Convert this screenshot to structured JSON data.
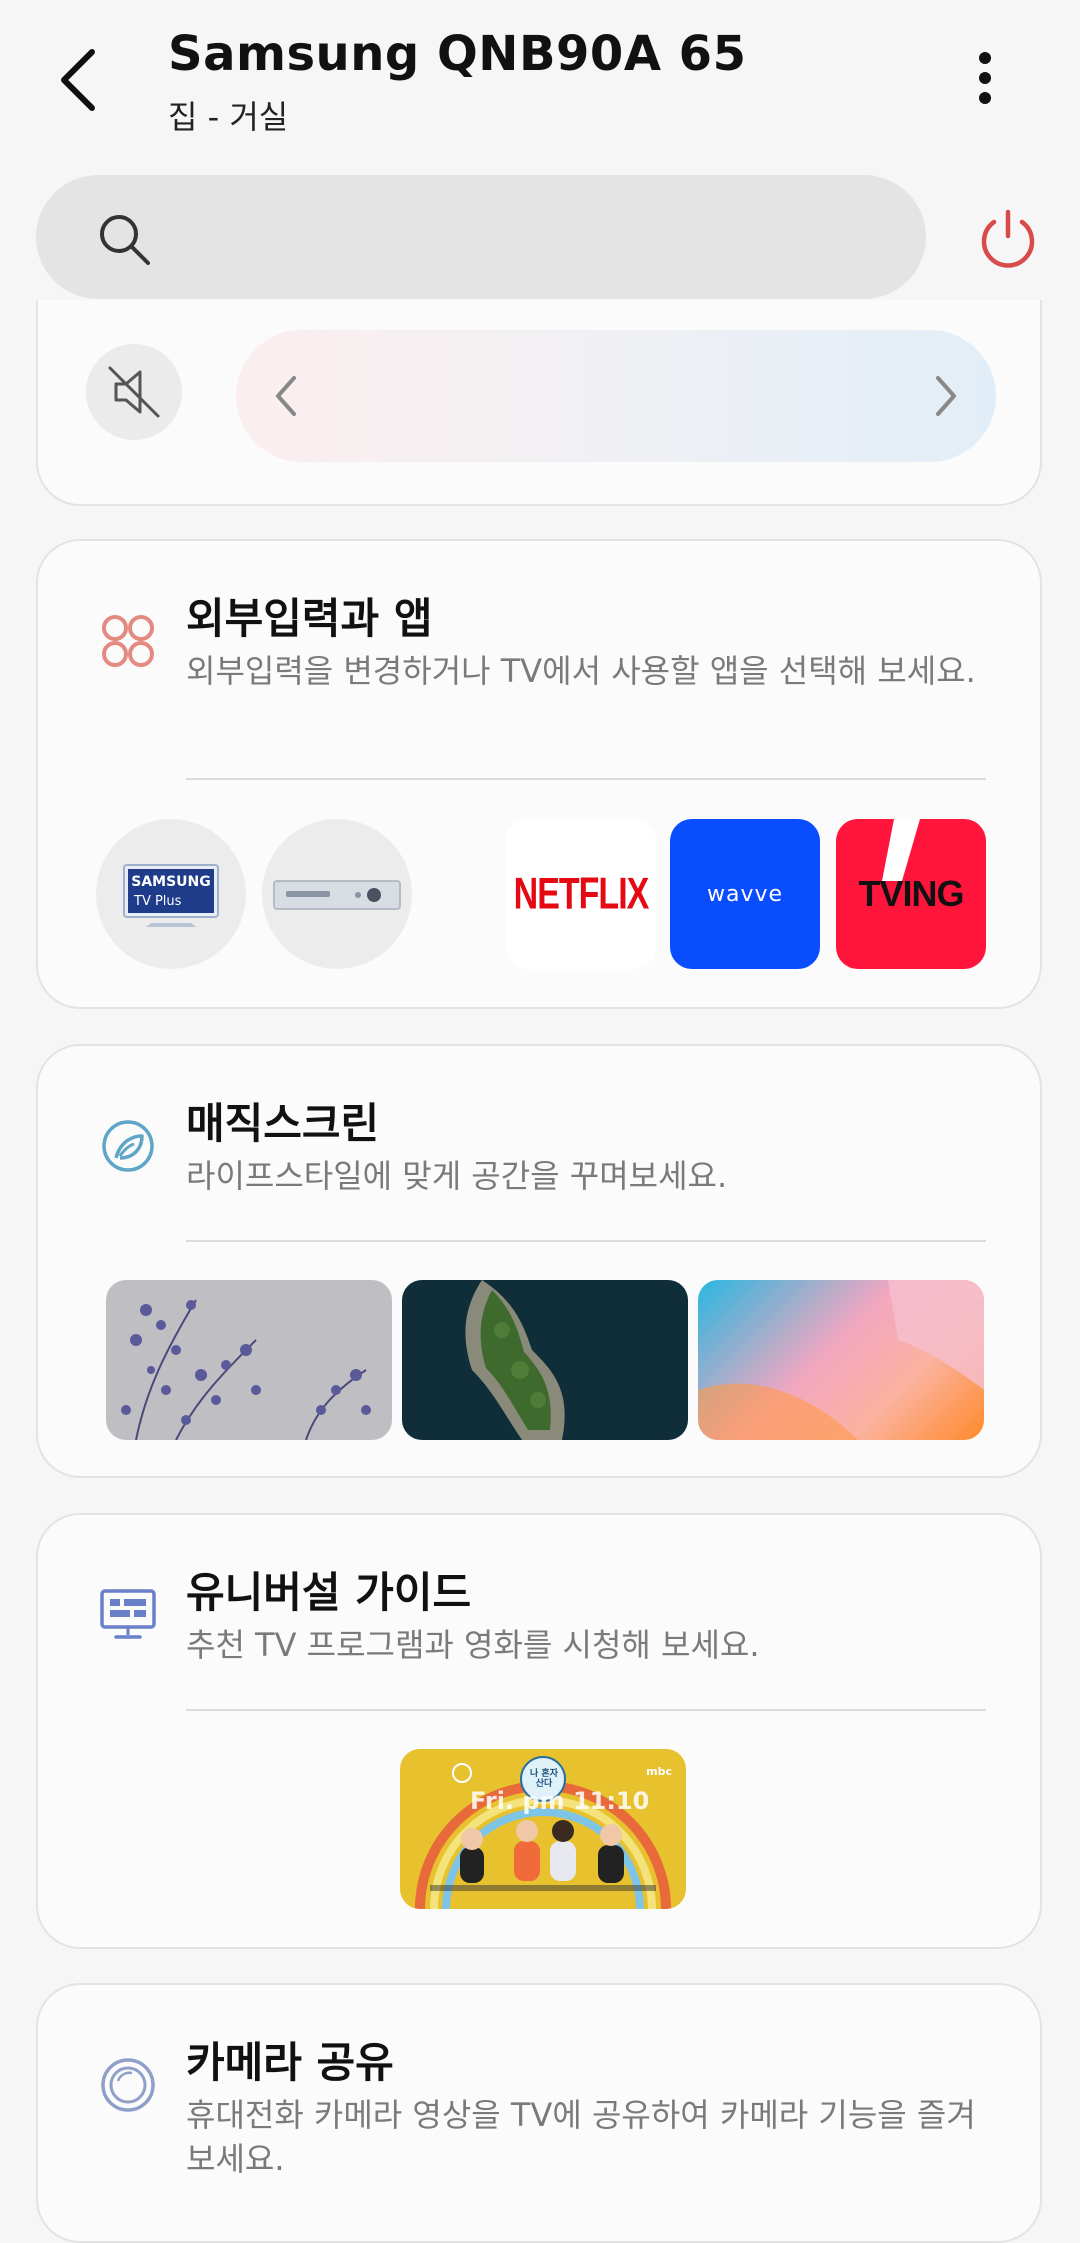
{
  "header": {
    "title": "Samsung QNB90A 65",
    "subtitle": "집 - 거실"
  },
  "icons": {
    "back": "chevron-left-icon",
    "more": "more-vertical-icon",
    "search": "search-icon",
    "power": "power-icon",
    "mute": "volume-mute-icon"
  },
  "colors": {
    "power": "#d94a4a",
    "apps_icon": "#e58a80",
    "magic_icon": "#5ea5c6",
    "guide_icon": "#6a80c8",
    "camera_icon": "#8e9fc8",
    "netflix": "#e50914",
    "wavve": "#0a4dff",
    "tving": "#ff153c"
  },
  "sources_apps": {
    "title": "외부입력과 앱",
    "description": "외부입력을 변경하거나 TV에서 사용할 앱을 선택해 보세요.",
    "sources": [
      {
        "name": "samsung-tv-plus",
        "line1": "SAMSUNG",
        "line2": "TV Plus"
      },
      {
        "name": "set-top-box"
      }
    ],
    "apps": [
      {
        "name": "netflix",
        "label": "NETFLIX"
      },
      {
        "name": "wavve",
        "label": "wavve"
      },
      {
        "name": "tving",
        "label": "TVING"
      }
    ]
  },
  "magic_screen": {
    "title": "매직스크린",
    "description": "라이프스타일에 맞게 공간을 꾸며보세요."
  },
  "universal_guide": {
    "title": "유니버설 가이드",
    "description": "추천 TV 프로그램과 영화를 시청해 보세요.",
    "thumbnail": {
      "show_badge": "나 혼자 산다",
      "broadcaster": "mbc",
      "schedule": "Fri. pm 11:10"
    }
  },
  "camera_share": {
    "title": "카메라 공유",
    "description": "휴대전화 카메라 영상을 TV에 공유하여 카메라 기능을 즐겨보세요."
  }
}
